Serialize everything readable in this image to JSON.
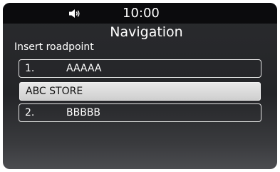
{
  "status_bar": {
    "time": "10:00",
    "volume_icon": "speaker-icon"
  },
  "screen": {
    "title": "Navigation",
    "subtitle": "Insert roadpoint",
    "items": [
      {
        "index": "1.",
        "label": "AAAAA",
        "selected": false
      },
      {
        "index": "",
        "label": "ABC STORE",
        "selected": true
      },
      {
        "index": "2.",
        "label": "BBBBB",
        "selected": false
      }
    ]
  }
}
